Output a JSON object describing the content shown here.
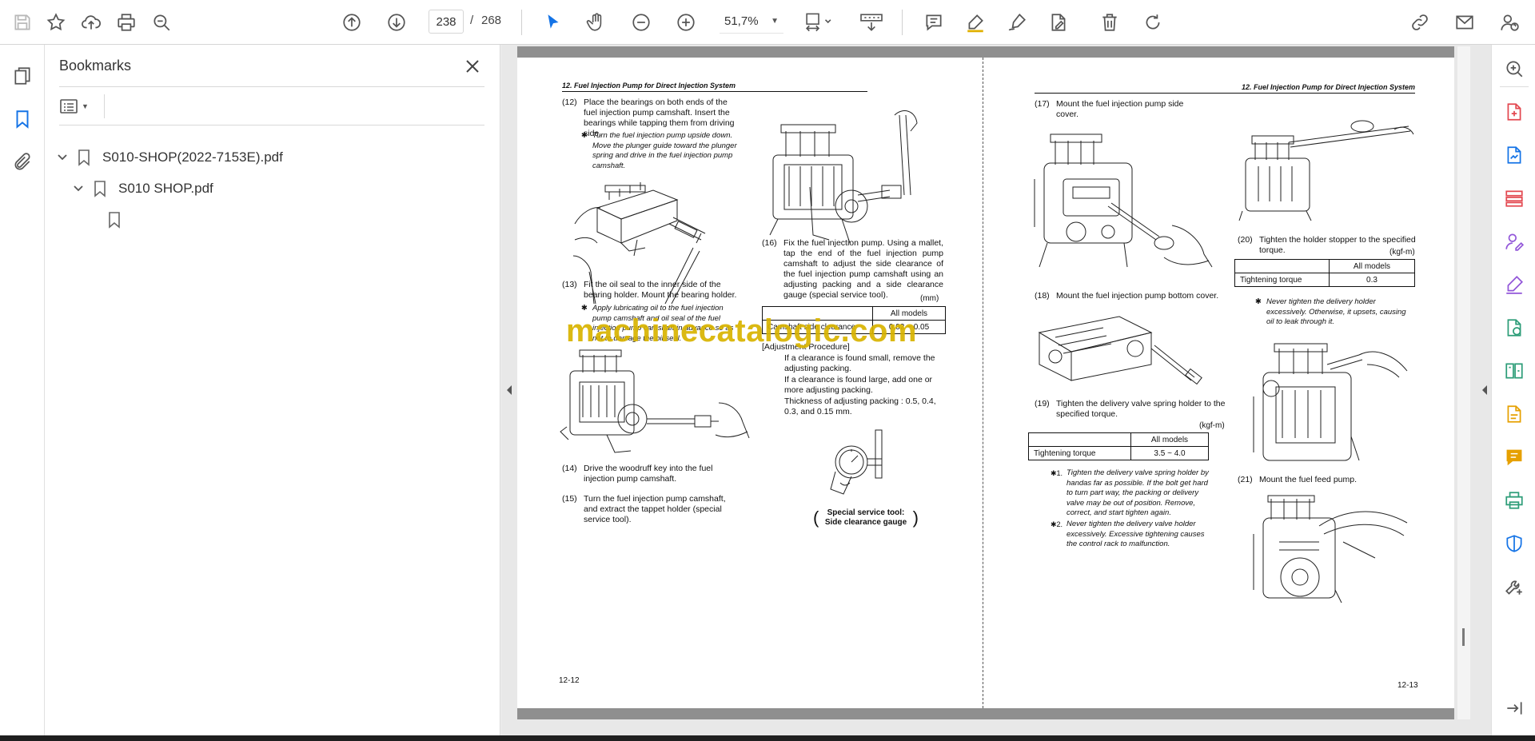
{
  "toolbar": {
    "current_page": "238",
    "page_separator": "/",
    "total_pages": "268",
    "zoom": "51,7%"
  },
  "bookmarks": {
    "title": "Bookmarks",
    "items": [
      {
        "label": "S010-SHOP(2022-7153E).pdf"
      },
      {
        "label": "S010 SHOP.pdf"
      },
      {
        "label": ""
      }
    ]
  },
  "document": {
    "left_page": {
      "running_head": "12. Fuel Injection Pump for Direct Injection System",
      "page_number": "12-12",
      "steps": {
        "s12_num": "(12)",
        "s12": "Place the bearings on both ends of the fuel injection pump camshaft. Insert the bearings while tapping them from driving side.",
        "s12_note": "Turn the fuel injection pump upside down. Move the plunger guide toward the plunger spring and drive in the fuel injection pump camshaft.",
        "s13_num": "(13)",
        "s13": "Fit the oil seal to the inner side of the bearing holder. Mount the bearing holder.",
        "s13_note": "Apply lubricating oil to the fuel injection pump camshaft and oil seal of the fuel injection pump camshaft in advance so as not to damage the oil seal.",
        "s14_num": "(14)",
        "s14": "Drive the woodruff key into the fuel injection pump camshaft.",
        "s15_num": "(15)",
        "s15": "Turn the fuel injection pump camshaft, and extract the tappet holder (special service tool).",
        "s16_num": "(16)",
        "s16": "Fix the fuel injection pump. Using a mallet, tap the end of the fuel injection pump camshaft to adjust the side clearance of the fuel injection pump camshaft using an adjusting packing and a side clearance gauge (special service tool).",
        "s16_unit": "(mm)",
        "s16_table_header": "All models",
        "s16_table_row_label": "Camshaft side clearance",
        "s16_table_row_value": "0.02 ~ 0.05",
        "adj_heading": "[Adjustment Procedure]",
        "adj_1": "If a clearance is found small, remove the adjusting packing.",
        "adj_2": "If a clearance is found large, add one or more adjusting packing.",
        "adj_3": "Thickness of adjusting packing : 0.5, 0.4, 0.3, and 0.15 mm.",
        "tool_caption_1": "Special service tool:",
        "tool_caption_2": "Side clearance gauge"
      }
    },
    "right_page": {
      "running_head": "12. Fuel Injection Pump for Direct Injection System",
      "page_number": "12-13",
      "steps": {
        "s17_num": "(17)",
        "s17": "Mount the fuel injection pump side cover.",
        "s18_num": "(18)",
        "s18": "Mount the fuel injection pump bottom cover.",
        "s19_num": "(19)",
        "s19": "Tighten the delivery valve spring holder to the specified torque.",
        "s19_unit": "(kgf-m)",
        "s19_table_header": "All models",
        "s19_table_row_label": "Tightening torque",
        "s19_table_row_value": "3.5 ~ 4.0",
        "s19_note1_mark": "✱1.",
        "s19_note1": "Tighten the delivery valve spring holder by handas far as possible. If the bolt get hard to turn part way, the packing or delivery valve may be out of position. Remove, correct, and start tighten again.",
        "s19_note2_mark": "✱2.",
        "s19_note2": "Never tighten the delivery valve holder excessively. Excessive tightening causes the control rack to malfunction.",
        "s20_num": "(20)",
        "s20": "Tighten the holder stopper to the specified torque.",
        "s20_unit": "(kgf-m)",
        "s20_table_header": "All models",
        "s20_table_row_label": "Tightening torque",
        "s20_table_row_value": "0.3",
        "s20_note": "Never tighten the delivery holder excessively. Otherwise, it upsets, causing oil to leak through it.",
        "s21_num": "(21)",
        "s21": "Mount the fuel feed pump."
      }
    },
    "watermark": "machinecatalogic.com"
  },
  "colors": {
    "accent_blue": "#1473e6",
    "tool_red": "#e34850",
    "tool_purple": "#9256d9",
    "tool_green": "#2d9d78",
    "tool_yellow": "#e6a000",
    "watermark": "#d9b400"
  }
}
